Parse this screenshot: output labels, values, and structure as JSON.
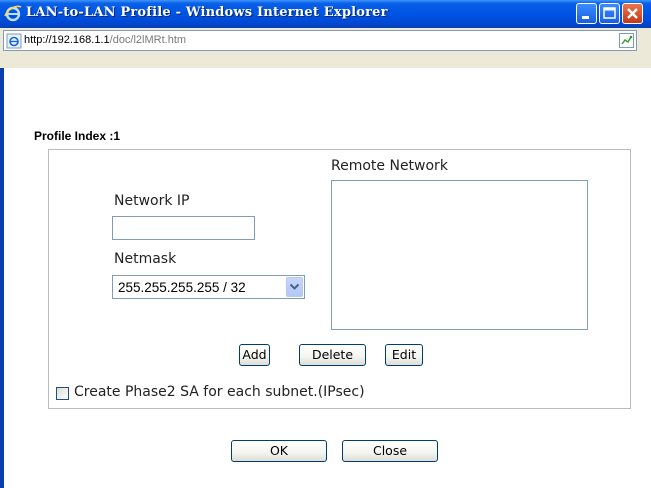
{
  "window": {
    "title": "LAN-to-LAN Profile - Windows Internet Explorer",
    "url_host": "http://192.168.1.1",
    "url_path": "/doc/l2lMRt.htm"
  },
  "form": {
    "profile_index": "Profile Index :1",
    "remote_network_label": "Remote Network",
    "network_ip_label": "Network IP",
    "network_ip_value": "",
    "netmask_label": "Netmask",
    "netmask_selected": "255.255.255.255 / 32",
    "remote_network_items": [],
    "add_label": "Add",
    "delete_label": "Delete",
    "edit_label": "Edit",
    "phase2_label": "Create Phase2 SA for each subnet.(IPsec)",
    "phase2_checked": false
  },
  "footer": {
    "ok_label": "OK",
    "close_label": "Close"
  },
  "colors": {
    "titlebar": "#0055e5",
    "close_button": "#c4371a",
    "chrome": "#ece9d8",
    "button_border": "#003c74"
  }
}
